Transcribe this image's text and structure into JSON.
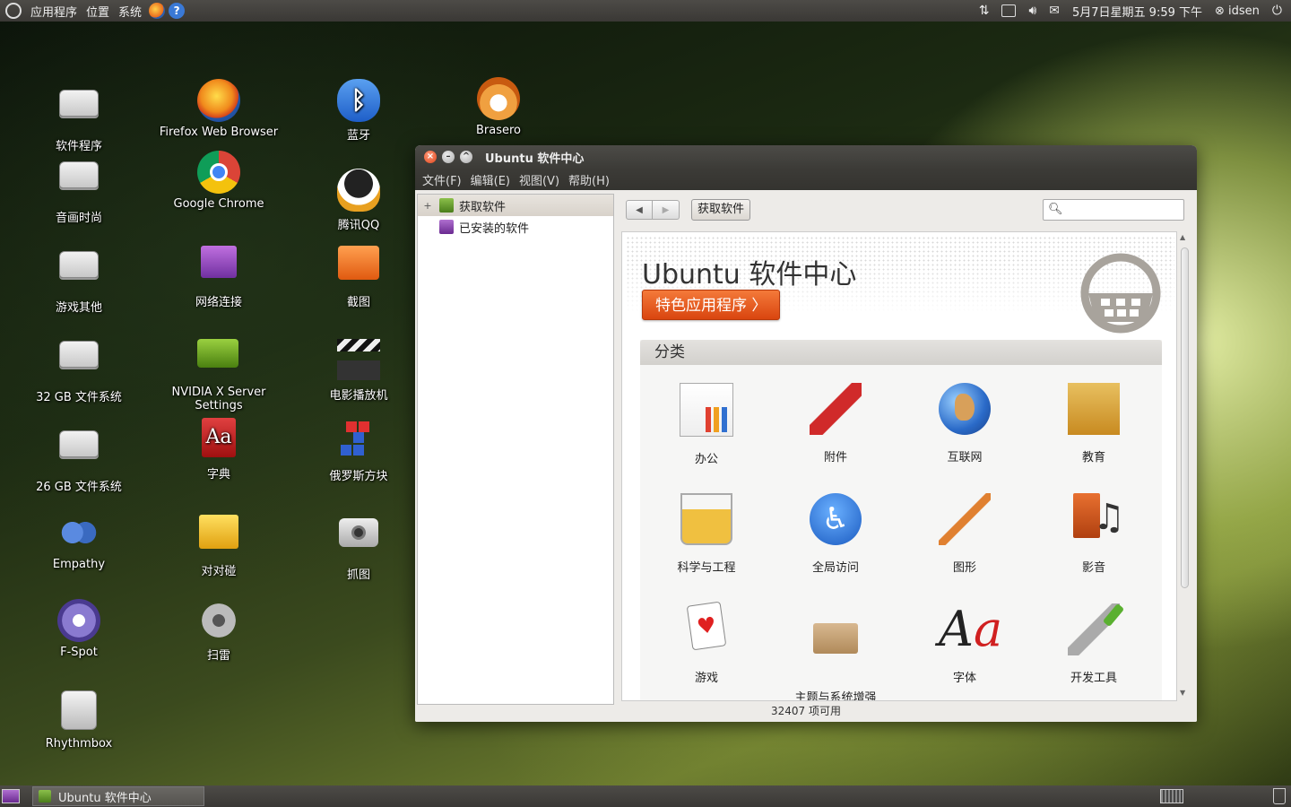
{
  "top_panel": {
    "menus": [
      "应用程序",
      "位置",
      "系统"
    ],
    "datetime": "5月7日星期五  9:59 下午",
    "user": "idsen",
    "help_glyph": "?"
  },
  "desktop_icons": [
    {
      "label": "软件程序",
      "icon": "drive-icon"
    },
    {
      "label": "音画时尚",
      "icon": "drive-icon"
    },
    {
      "label": "游戏其他",
      "icon": "drive-icon"
    },
    {
      "label": "32 GB 文件系统",
      "icon": "drive-icon"
    },
    {
      "label": "26 GB 文件系统",
      "icon": "drive-icon"
    },
    {
      "label": "Empathy",
      "icon": "empathy-icon"
    },
    {
      "label": "F-Spot",
      "icon": "fspot-icon"
    },
    {
      "label": "Rhythmbox",
      "icon": "rhythmbox-icon"
    },
    {
      "label": "Firefox Web Browser",
      "icon": "firefox-icon"
    },
    {
      "label": "Google Chrome",
      "icon": "chrome-icon"
    },
    {
      "label": "网络连接",
      "icon": "network-icon"
    },
    {
      "label": "NVIDIA X Server Settings",
      "icon": "nvidia-icon"
    },
    {
      "label": "字典",
      "icon": "dictionary-icon"
    },
    {
      "label": "对对碰",
      "icon": "blocks-icon"
    },
    {
      "label": "扫雷",
      "icon": "mines-icon"
    },
    {
      "label": "蓝牙",
      "icon": "bluetooth-icon"
    },
    {
      "label": "腾讯QQ",
      "icon": "qq-icon"
    },
    {
      "label": "截图",
      "icon": "screenshot-folder-icon"
    },
    {
      "label": "电影播放机",
      "icon": "movie-player-icon"
    },
    {
      "label": "俄罗斯方块",
      "icon": "tetris-icon"
    },
    {
      "label": "抓图",
      "icon": "camera-icon"
    },
    {
      "label": "Brasero",
      "icon": "brasero-icon"
    }
  ],
  "window": {
    "title": "Ubuntu 软件中心",
    "menus": [
      "文件(F)",
      "编辑(E)",
      "视图(V)",
      "帮助(H)"
    ],
    "sidebar": [
      {
        "label": "获取软件",
        "expander": "+",
        "selected": true
      },
      {
        "label": "已安装的软件",
        "expander": "",
        "selected": false
      }
    ],
    "toolbar": {
      "back_glyph": "◀",
      "forward_glyph": "▶",
      "breadcrumb": "获取软件",
      "search_placeholder": ""
    },
    "banner": {
      "title": "Ubuntu 软件中心",
      "featured_button": "特色应用程序 〉"
    },
    "categories_header": "分类",
    "categories": [
      {
        "label": "办公",
        "icon": "office-icon"
      },
      {
        "label": "附件",
        "icon": "accessories-icon"
      },
      {
        "label": "互联网",
        "icon": "internet-icon"
      },
      {
        "label": "教育",
        "icon": "education-icon"
      },
      {
        "label": "科学与工程",
        "icon": "science-icon"
      },
      {
        "label": "全局访问",
        "icon": "accessibility-icon"
      },
      {
        "label": "图形",
        "icon": "graphics-icon"
      },
      {
        "label": "影音",
        "icon": "multimedia-icon"
      },
      {
        "label": "游戏",
        "icon": "games-icon"
      },
      {
        "label": "主题与系统增强",
        "icon": "themes-icon"
      },
      {
        "label": "字体",
        "icon": "fonts-icon"
      },
      {
        "label": "开发工具",
        "icon": "developer-tools-icon"
      }
    ],
    "status": "32407 项可用"
  },
  "bottom_panel": {
    "task_label": "Ubuntu 软件中心"
  },
  "colors": {
    "accent": "#e05a1c",
    "panel": "#3c3b37"
  }
}
